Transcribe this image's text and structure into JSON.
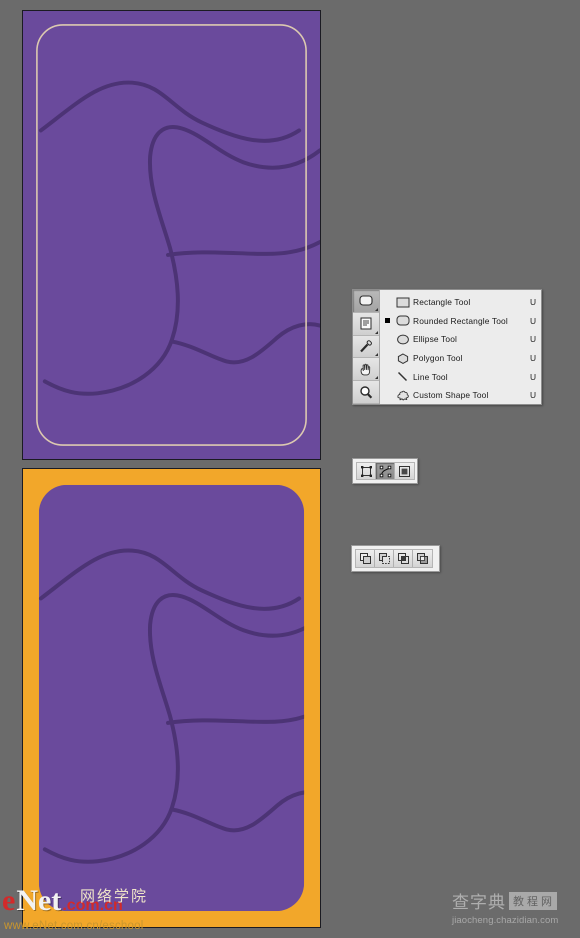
{
  "app": {
    "kind": "image-editor-tutorial-screenshot",
    "background_color": "#6b6b6b"
  },
  "documents": [
    {
      "name": "top-document",
      "background_color": "#6a4a9c",
      "border_color": "#1b1b22",
      "inner_stroke_color": "#dcc9b0",
      "curve_color": "#4a3272",
      "description": "purple canvas with thin light rounded-rectangle path outline and dark purple curved strokes"
    },
    {
      "name": "bottom-document",
      "background_color": "#f2a72a",
      "border_color": "#1b1b22",
      "inner_fill_color": "#6a4a9c",
      "curve_color": "#4a3272",
      "description": "orange frame with filled purple rounded rectangle and dark purple curved strokes"
    }
  ],
  "tool_flyout": {
    "name": "shape-tool-flyout",
    "rail_tools": [
      {
        "name": "rounded-rectangle-tool",
        "icon": "rounded-rectangle-icon",
        "active": true
      },
      {
        "name": "notes-tool",
        "icon": "notes-icon",
        "active": false
      },
      {
        "name": "eyedropper-tool",
        "icon": "eyedropper-icon",
        "active": false
      },
      {
        "name": "hand-tool",
        "icon": "hand-icon",
        "active": false
      },
      {
        "name": "zoom-tool",
        "icon": "magnifier-icon",
        "active": false
      }
    ],
    "items": [
      {
        "label": "Rectangle Tool",
        "shortcut": "U",
        "icon": "rectangle-icon",
        "selected": false
      },
      {
        "label": "Rounded Rectangle Tool",
        "shortcut": "U",
        "icon": "rounded-rectangle-icon",
        "selected": true
      },
      {
        "label": "Ellipse Tool",
        "shortcut": "U",
        "icon": "ellipse-icon",
        "selected": false
      },
      {
        "label": "Polygon Tool",
        "shortcut": "U",
        "icon": "polygon-icon",
        "selected": false
      },
      {
        "label": "Line Tool",
        "shortcut": "U",
        "icon": "line-icon",
        "selected": false
      },
      {
        "label": "Custom Shape Tool",
        "shortcut": "U",
        "icon": "custom-shape-icon",
        "selected": false
      }
    ]
  },
  "shape_mode_bar": {
    "name": "shape-mode-bar",
    "buttons": [
      {
        "name": "shape-layers-button",
        "icon": "shape-layer-icon",
        "active": false
      },
      {
        "name": "paths-button",
        "icon": "path-icon",
        "active": true
      },
      {
        "name": "fill-pixels-button",
        "icon": "filled-square-icon",
        "active": false
      }
    ]
  },
  "path_op_bar": {
    "name": "path-operations-bar",
    "buttons": [
      {
        "name": "add-to-path-area-button",
        "icon": "add-shape-icon",
        "active": false
      },
      {
        "name": "subtract-from-path-area-button",
        "icon": "subtract-shape-icon",
        "active": false
      },
      {
        "name": "intersect-path-areas-button",
        "icon": "intersect-shape-icon",
        "active": false
      },
      {
        "name": "exclude-overlapping-areas-button",
        "icon": "exclude-shape-icon",
        "active": false
      }
    ]
  },
  "watermarks": {
    "enet": {
      "letter_e": "e",
      "word_net": "Net",
      "domain": ".com.cn",
      "chinese": "网络学院",
      "url": "www.eNet.com.cn/eschool"
    },
    "chazidian": {
      "chinese": "查字典",
      "boxed": "教程网",
      "url": "jiaocheng.chazidian.com"
    }
  }
}
